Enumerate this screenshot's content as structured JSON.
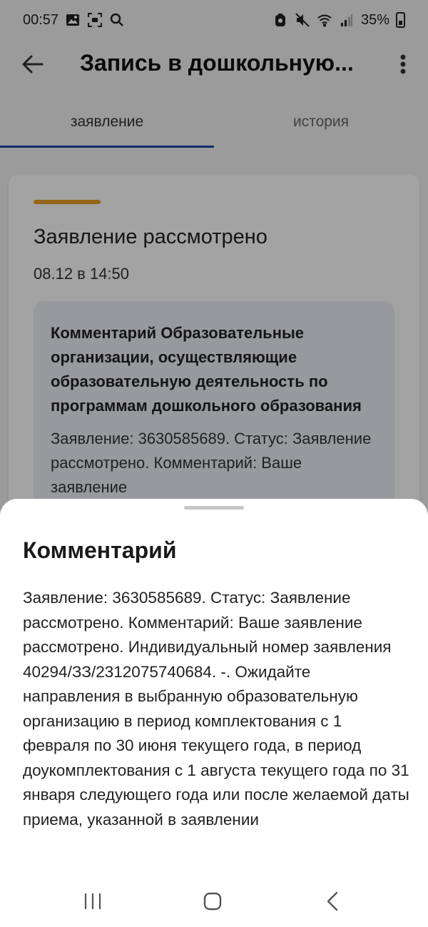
{
  "status_bar": {
    "time": "00:57",
    "battery": "35%"
  },
  "header": {
    "title": "Запись в дошкольную..."
  },
  "tabs": [
    {
      "label": "заявление",
      "active": true
    },
    {
      "label": "история",
      "active": false
    }
  ],
  "card": {
    "status_title": "Заявление рассмотрено",
    "date": "08.12 в 14:50",
    "comment_title": "Комментарий Образовательные организации, осуществляющие образовательную деятельность по программам дошкольного образования",
    "comment_preview": "Заявление: 3630585689. Статус: Заявление рассмотрено. Комментарий: Ваше заявление"
  },
  "sheet": {
    "title": "Комментарий",
    "text": "Заявление: 3630585689. Статус: Заявление рассмотрено. Комментарий: Ваше заявление рассмотрено. Индивидуальный номер заявления 40294/ЗЗ/2312075740684. -. Ожидайте направления в выбранную образовательную организацию в период комплектования с 1 февраля по 30 июня текущего года, в период доукомплектования с 1 августа текущего года по 31 января следующего года или после желаемой даты приема, указанной в заявлении"
  },
  "colors": {
    "accent_tab": "#1a47a8",
    "status_accent": "#e8a023"
  },
  "icons": {
    "back": "arrow-left-icon",
    "more": "more-vertical-icon",
    "nav_recents": "recent-apps-icon",
    "nav_home": "home-icon",
    "nav_back": "chevron-left-icon"
  }
}
